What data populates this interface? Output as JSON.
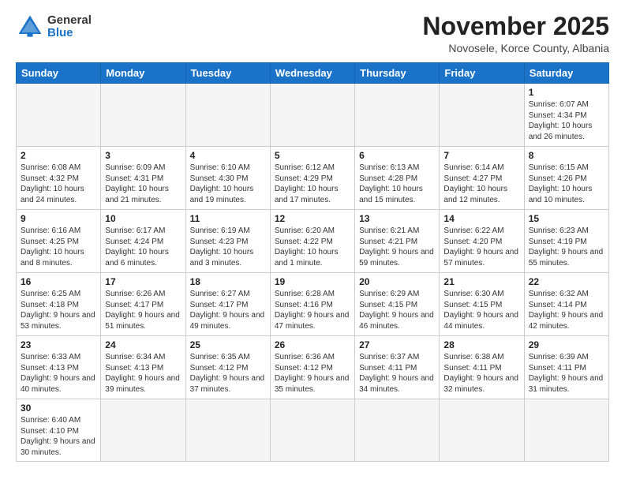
{
  "logo": {
    "general": "General",
    "blue": "Blue"
  },
  "title": "November 2025",
  "subtitle": "Novosele, Korce County, Albania",
  "weekdays": [
    "Sunday",
    "Monday",
    "Tuesday",
    "Wednesday",
    "Thursday",
    "Friday",
    "Saturday"
  ],
  "weeks": [
    [
      {
        "day": "",
        "info": ""
      },
      {
        "day": "",
        "info": ""
      },
      {
        "day": "",
        "info": ""
      },
      {
        "day": "",
        "info": ""
      },
      {
        "day": "",
        "info": ""
      },
      {
        "day": "",
        "info": ""
      },
      {
        "day": "1",
        "info": "Sunrise: 6:07 AM\nSunset: 4:34 PM\nDaylight: 10 hours\nand 26 minutes."
      }
    ],
    [
      {
        "day": "2",
        "info": "Sunrise: 6:08 AM\nSunset: 4:32 PM\nDaylight: 10 hours\nand 24 minutes."
      },
      {
        "day": "3",
        "info": "Sunrise: 6:09 AM\nSunset: 4:31 PM\nDaylight: 10 hours\nand 21 minutes."
      },
      {
        "day": "4",
        "info": "Sunrise: 6:10 AM\nSunset: 4:30 PM\nDaylight: 10 hours\nand 19 minutes."
      },
      {
        "day": "5",
        "info": "Sunrise: 6:12 AM\nSunset: 4:29 PM\nDaylight: 10 hours\nand 17 minutes."
      },
      {
        "day": "6",
        "info": "Sunrise: 6:13 AM\nSunset: 4:28 PM\nDaylight: 10 hours\nand 15 minutes."
      },
      {
        "day": "7",
        "info": "Sunrise: 6:14 AM\nSunset: 4:27 PM\nDaylight: 10 hours\nand 12 minutes."
      },
      {
        "day": "8",
        "info": "Sunrise: 6:15 AM\nSunset: 4:26 PM\nDaylight: 10 hours\nand 10 minutes."
      }
    ],
    [
      {
        "day": "9",
        "info": "Sunrise: 6:16 AM\nSunset: 4:25 PM\nDaylight: 10 hours\nand 8 minutes."
      },
      {
        "day": "10",
        "info": "Sunrise: 6:17 AM\nSunset: 4:24 PM\nDaylight: 10 hours\nand 6 minutes."
      },
      {
        "day": "11",
        "info": "Sunrise: 6:19 AM\nSunset: 4:23 PM\nDaylight: 10 hours\nand 3 minutes."
      },
      {
        "day": "12",
        "info": "Sunrise: 6:20 AM\nSunset: 4:22 PM\nDaylight: 10 hours\nand 1 minute."
      },
      {
        "day": "13",
        "info": "Sunrise: 6:21 AM\nSunset: 4:21 PM\nDaylight: 9 hours\nand 59 minutes."
      },
      {
        "day": "14",
        "info": "Sunrise: 6:22 AM\nSunset: 4:20 PM\nDaylight: 9 hours\nand 57 minutes."
      },
      {
        "day": "15",
        "info": "Sunrise: 6:23 AM\nSunset: 4:19 PM\nDaylight: 9 hours\nand 55 minutes."
      }
    ],
    [
      {
        "day": "16",
        "info": "Sunrise: 6:25 AM\nSunset: 4:18 PM\nDaylight: 9 hours\nand 53 minutes."
      },
      {
        "day": "17",
        "info": "Sunrise: 6:26 AM\nSunset: 4:17 PM\nDaylight: 9 hours\nand 51 minutes."
      },
      {
        "day": "18",
        "info": "Sunrise: 6:27 AM\nSunset: 4:17 PM\nDaylight: 9 hours\nand 49 minutes."
      },
      {
        "day": "19",
        "info": "Sunrise: 6:28 AM\nSunset: 4:16 PM\nDaylight: 9 hours\nand 47 minutes."
      },
      {
        "day": "20",
        "info": "Sunrise: 6:29 AM\nSunset: 4:15 PM\nDaylight: 9 hours\nand 46 minutes."
      },
      {
        "day": "21",
        "info": "Sunrise: 6:30 AM\nSunset: 4:15 PM\nDaylight: 9 hours\nand 44 minutes."
      },
      {
        "day": "22",
        "info": "Sunrise: 6:32 AM\nSunset: 4:14 PM\nDaylight: 9 hours\nand 42 minutes."
      }
    ],
    [
      {
        "day": "23",
        "info": "Sunrise: 6:33 AM\nSunset: 4:13 PM\nDaylight: 9 hours\nand 40 minutes."
      },
      {
        "day": "24",
        "info": "Sunrise: 6:34 AM\nSunset: 4:13 PM\nDaylight: 9 hours\nand 39 minutes."
      },
      {
        "day": "25",
        "info": "Sunrise: 6:35 AM\nSunset: 4:12 PM\nDaylight: 9 hours\nand 37 minutes."
      },
      {
        "day": "26",
        "info": "Sunrise: 6:36 AM\nSunset: 4:12 PM\nDaylight: 9 hours\nand 35 minutes."
      },
      {
        "day": "27",
        "info": "Sunrise: 6:37 AM\nSunset: 4:11 PM\nDaylight: 9 hours\nand 34 minutes."
      },
      {
        "day": "28",
        "info": "Sunrise: 6:38 AM\nSunset: 4:11 PM\nDaylight: 9 hours\nand 32 minutes."
      },
      {
        "day": "29",
        "info": "Sunrise: 6:39 AM\nSunset: 4:11 PM\nDaylight: 9 hours\nand 31 minutes."
      }
    ],
    [
      {
        "day": "30",
        "info": "Sunrise: 6:40 AM\nSunset: 4:10 PM\nDaylight: 9 hours\nand 30 minutes."
      },
      {
        "day": "",
        "info": ""
      },
      {
        "day": "",
        "info": ""
      },
      {
        "day": "",
        "info": ""
      },
      {
        "day": "",
        "info": ""
      },
      {
        "day": "",
        "info": ""
      },
      {
        "day": "",
        "info": ""
      }
    ]
  ]
}
